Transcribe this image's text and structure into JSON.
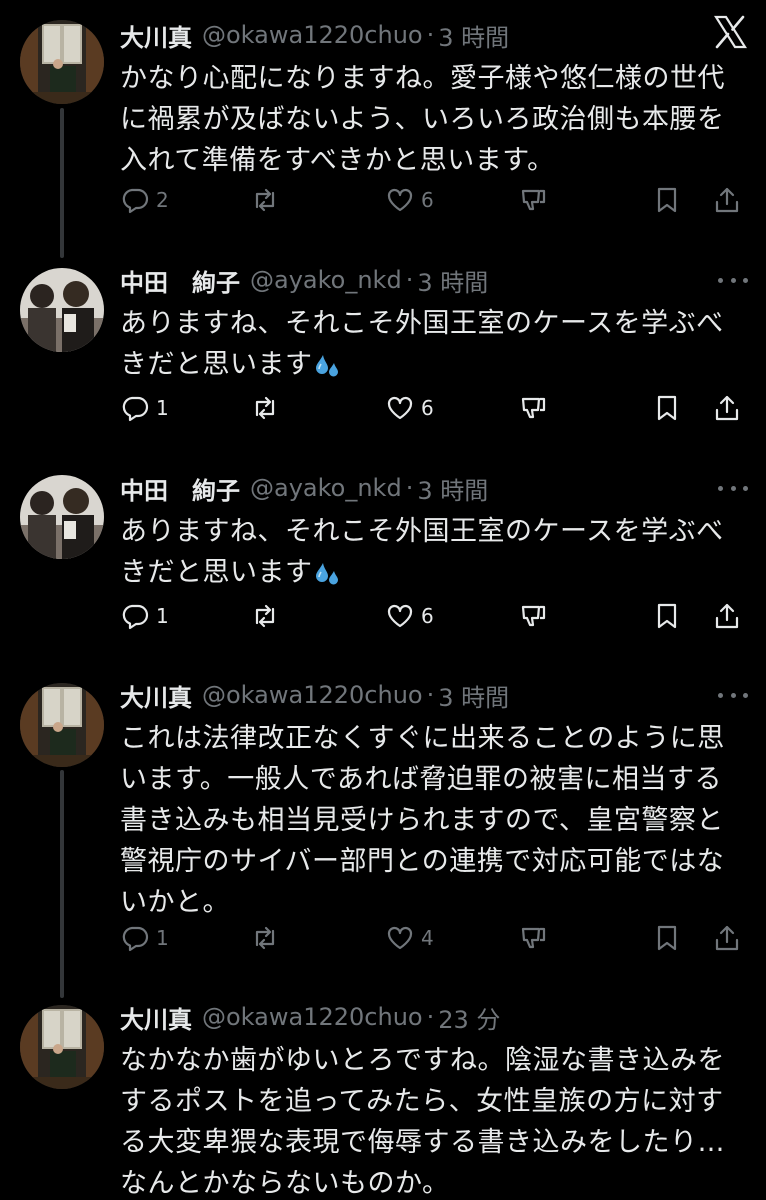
{
  "tweets": [
    {
      "name": "大川真",
      "handle": "@okawa1220chuo",
      "separator": "·",
      "time": "3 時間",
      "text_lines": [
        "かなり心配になりますね。愛子様や悠仁様の世代",
        "に禍累が及ばないよう、いろいろ政治側も本腰を",
        "入れて準備をすべきかと思います。"
      ],
      "reply_count": "2",
      "retweet_count": "",
      "like_count": "6",
      "emoji": ""
    },
    {
      "name": "中田　絢子",
      "handle": "@ayako_nkd",
      "separator": "·",
      "time": "3 時間",
      "text_lines": [
        "ありますね、それこそ外国王室のケースを学ぶべ",
        "きだと思います"
      ],
      "reply_count": "1",
      "retweet_count": "",
      "like_count": "6",
      "emoji": "sweat-droplets"
    },
    {
      "name": "中田　絢子",
      "handle": "@ayako_nkd",
      "separator": "·",
      "time": "3 時間",
      "text_lines": [
        "ありますね、それこそ外国王室のケースを学ぶべ",
        "きだと思います"
      ],
      "reply_count": "1",
      "retweet_count": "",
      "like_count": "6",
      "emoji": "sweat-droplets"
    },
    {
      "name": "大川真",
      "handle": "@okawa1220chuo",
      "separator": "·",
      "time": "3 時間",
      "text_lines": [
        "これは法律改正なくすぐに出来ることのように思",
        "います。一般人であれば脅迫罪の被害に相当する",
        "書き込みも相当見受けられますので、皇宮警察と",
        "警視庁のサイバー部門との連携で対応可能ではな",
        "いかと。"
      ],
      "reply_count": "1",
      "retweet_count": "",
      "like_count": "4",
      "emoji": ""
    },
    {
      "name": "大川真",
      "handle": "@okawa1220chuo",
      "separator": "·",
      "time": "23 分",
      "text_lines": [
        "なかなか歯がゆいとろですね。陰湿な書き込みを",
        "するポストを追ってみたら、女性皇族の方に対す",
        "る大変卑猥な表現で侮辱する書き込みをしたり…",
        "なんとかならないものか。"
      ],
      "reply_count": "",
      "retweet_count": "",
      "like_count": "",
      "emoji": ""
    }
  ],
  "icons": {
    "close": "close-x-icon",
    "reply": "reply-icon",
    "retweet": "retweet-icon",
    "like": "heart-icon",
    "downvote": "downvote-icon",
    "bookmark": "bookmark-icon",
    "share": "share-icon",
    "more": "more-dots-icon"
  },
  "colors": {
    "background": "#000000",
    "text": "#e7e9ea",
    "muted": "#71767b",
    "thread_line": "#333639",
    "emoji_blue": "#4aa3df"
  }
}
